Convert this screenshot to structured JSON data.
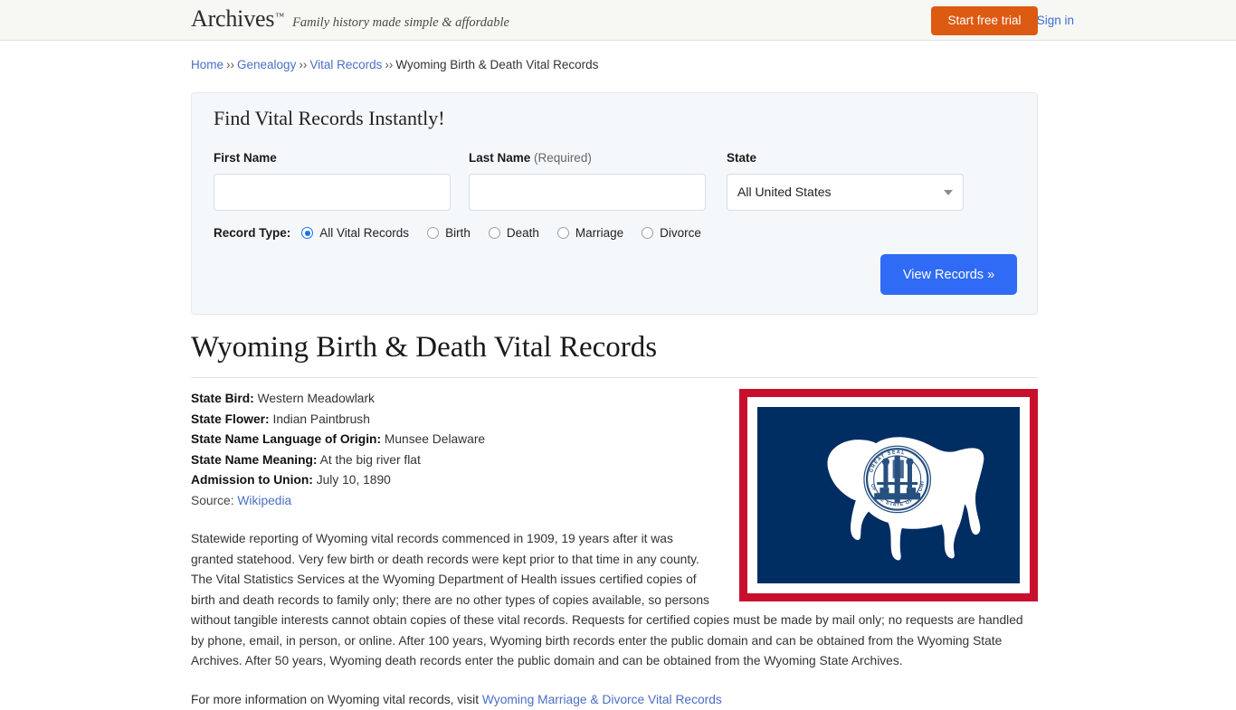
{
  "header": {
    "brand_name": "Archives",
    "brand_tm": "™",
    "tagline": "Family history made simple & affordable",
    "sign_in": "Sign in",
    "start_trial": "Start free trial"
  },
  "breadcrumb": {
    "items": [
      {
        "label": "Home",
        "link": true
      },
      {
        "label": "Genealogy",
        "link": true
      },
      {
        "label": "Vital Records",
        "link": true
      },
      {
        "label": "Wyoming Birth & Death Vital Records",
        "link": false
      }
    ],
    "separator": "››"
  },
  "search_panel": {
    "title": "Find Vital Records Instantly!",
    "first_name": {
      "label": "First Name",
      "value": "",
      "placeholder": ""
    },
    "last_name": {
      "label": "Last Name",
      "required_note": "(Required)",
      "value": "",
      "placeholder": ""
    },
    "state": {
      "label": "State",
      "selected": "All United States",
      "chevron": "chevron-down-icon"
    },
    "record_type": {
      "label": "Record Type:",
      "options": [
        {
          "label": "All Vital Records",
          "checked": true
        },
        {
          "label": "Birth",
          "checked": false
        },
        {
          "label": "Death",
          "checked": false
        },
        {
          "label": "Marriage",
          "checked": false
        },
        {
          "label": "Divorce",
          "checked": false
        }
      ]
    },
    "submit_label": "View Records »"
  },
  "article": {
    "title": "Wyoming Birth & Death Vital Records",
    "facts": [
      {
        "label": "State Bird:",
        "value": "Western Meadowlark"
      },
      {
        "label": "State Flower:",
        "value": "Indian Paintbrush"
      },
      {
        "label": "State Name Language of Origin:",
        "value": "Munsee Delaware"
      },
      {
        "label": "State Name Meaning:",
        "value": "At the big river flat"
      },
      {
        "label": "Admission to Union:",
        "value": "July 10, 1890"
      }
    ],
    "source_prefix": "Source:",
    "source_link": "Wikipedia",
    "paragraph": "Statewide reporting of Wyoming vital records commenced in 1909, 19 years after it was granted statehood. Very few birth or death records were kept prior to that time in any county. The Vital Statistics Services at the Wyoming Department of Health issues certified copies of birth and death records to family only; there are no other types of copies available, so persons without tangible interests cannot obtain copies of these vital records. Requests for certified copies must be made by mail only; no requests are handled by phone, email, in person, or online. After 100 years, Wyoming birth records enter the public domain and can be obtained from the Wyoming State Archives. After 50 years, Wyoming death records enter the public domain and can be obtained from the Wyoming State Archives.",
    "paragraph2_prefix": "For more information on Wyoming vital records, visit ",
    "paragraph2_link": "Wyoming Marriage & Divorce Vital Records",
    "flag": {
      "name": "wyoming-state-flag",
      "border_color": "#c8102e",
      "field_color": "#002d62",
      "band_color": "#ffffff",
      "seal_text": "GREAT SEAL OF THE STATE OF WYOMING"
    }
  },
  "colors": {
    "accent_orange": "#dd5a12",
    "accent_blue": "#2f6bf5",
    "link_blue": "#4a6fc4",
    "panel_bg": "#f4f8fb",
    "header_bg": "#f7f7f4"
  }
}
